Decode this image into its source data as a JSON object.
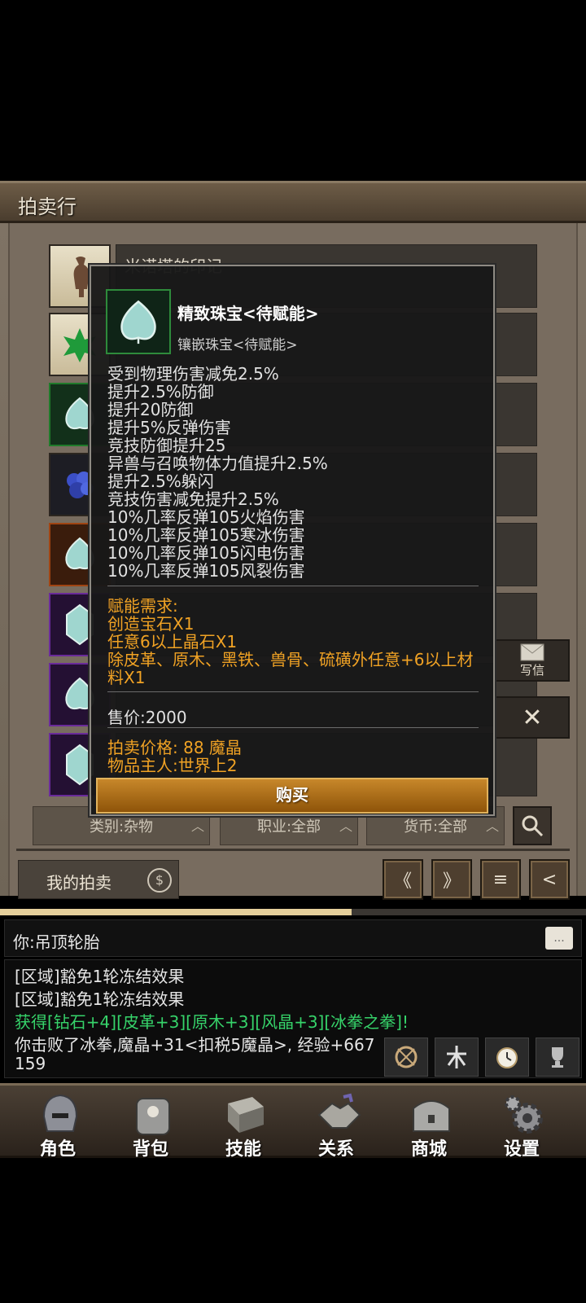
{
  "header": {
    "title": "拍卖行"
  },
  "listings": [
    {
      "name": "米诺塔的印记",
      "style": "paper",
      "icon": "minotaur-figure-icon"
    },
    {
      "name": "",
      "style": "paper",
      "icon": "green-leaf-icon"
    },
    {
      "name": "",
      "style": "green",
      "icon": "jewel-spade-icon"
    },
    {
      "name": "",
      "style": "dark",
      "icon": "blue-crystal-cluster-icon"
    },
    {
      "name": "",
      "style": "orange",
      "icon": "jewel-spade-icon"
    },
    {
      "name": "",
      "style": "purple",
      "icon": "jewel-gem-icon"
    },
    {
      "name": "",
      "style": "purple",
      "icon": "jewel-spade-icon"
    },
    {
      "name": "",
      "style": "purple",
      "icon": "jewel-gem-icon"
    }
  ],
  "side_buttons": {
    "write_letter": "写信",
    "close_symbol": "✕"
  },
  "tooltip": {
    "name": "精致珠宝<待赋能>",
    "subtitle": "镶嵌珠宝<待赋能>",
    "stats": [
      "受到物理伤害减免2.5%",
      "提升2.5%防御",
      "提升20防御",
      "提升5%反弹伤害",
      "竞技防御提升25",
      "异兽与召唤物体力值提升2.5%",
      "提升2.5%躲闪",
      "竞技伤害减免提升2.5%",
      "10%几率反弹105火焰伤害",
      "10%几率反弹105寒冰伤害",
      "10%几率反弹105闪电伤害",
      "10%几率反弹105风裂伤害"
    ],
    "requirements": [
      "赋能需求:",
      "创造宝石X1",
      "任意6以上晶石X1",
      "除皮革、原木、黑铁、兽骨、硫磺外任意+6以上材料X1"
    ],
    "sell_price": "售价:2000",
    "auction_price": "拍卖价格: 88 魔晶",
    "owner": "物品主人:世界上2",
    "buy_label": "购买"
  },
  "filters": {
    "category": "类别:杂物",
    "profession": "职业:全部",
    "currency": "货币:全部"
  },
  "my_auction": "我的拍卖",
  "coin_symbol": "$",
  "pager": [
    "《",
    "》",
    "≡",
    "<"
  ],
  "progress_fraction": 0.6,
  "chat": {
    "input_text": "你:吊顶轮胎",
    "bubble": "...",
    "log": [
      {
        "text": "[区域]豁免1轮冻结效果",
        "color": "white"
      },
      {
        "text": "[区域]豁免1轮冻结效果",
        "color": "white"
      },
      {
        "text": "获得[钻石+4][皮革+3][原木+3][风晶+3][冰拳之拳]!",
        "color": "green"
      },
      {
        "text": "你击败了冰拳,魔晶+31<扣税5魔晶>, 经验+667",
        "color": "white"
      },
      {
        "text": "159",
        "color": "white"
      }
    ]
  },
  "nav": [
    {
      "label": "角色",
      "icon": "helmet-icon"
    },
    {
      "label": "背包",
      "icon": "backpack-icon"
    },
    {
      "label": "技能",
      "icon": "spellbook-icon"
    },
    {
      "label": "关系",
      "icon": "handshake-icon"
    },
    {
      "label": "商城",
      "icon": "chest-icon"
    },
    {
      "label": "设置",
      "icon": "gear-icon"
    }
  ]
}
